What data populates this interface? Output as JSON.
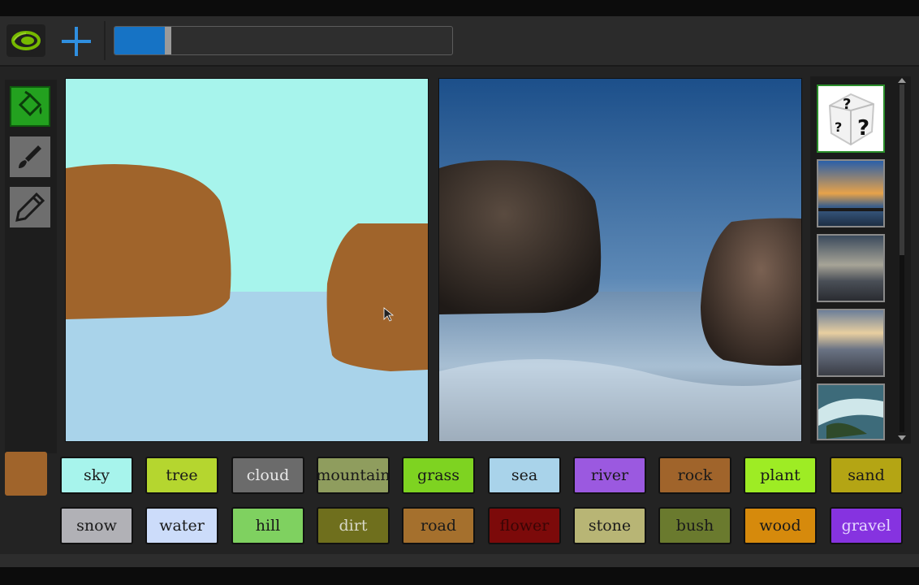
{
  "app": {
    "progress_percent": 15
  },
  "tools": [
    {
      "name": "paint-bucket",
      "active": true
    },
    {
      "name": "brush",
      "active": false
    },
    {
      "name": "pencil",
      "active": false
    }
  ],
  "current_color": "#a0642b",
  "palette": [
    {
      "label": "sky",
      "color": "#a7f4ec",
      "text": "#1a1a1a"
    },
    {
      "label": "tree",
      "color": "#b5d62f",
      "text": "#1a1a1a"
    },
    {
      "label": "cloud",
      "color": "#6b6b6b",
      "text": "#e8e8e8"
    },
    {
      "label": "mountain",
      "color": "#8f9d5e",
      "text": "#1a1a1a"
    },
    {
      "label": "grass",
      "color": "#7ed321",
      "text": "#1a1a1a"
    },
    {
      "label": "sea",
      "color": "#a9d3ea",
      "text": "#1a1a1a"
    },
    {
      "label": "river",
      "color": "#9b59e0",
      "text": "#1a1a1a"
    },
    {
      "label": "rock",
      "color": "#a0642b",
      "text": "#1a1a1a"
    },
    {
      "label": "plant",
      "color": "#9eec24",
      "text": "#1a1a1a"
    },
    {
      "label": "sand",
      "color": "#b4a514",
      "text": "#1a1a1a"
    },
    {
      "label": "snow",
      "color": "#b1b1b6",
      "text": "#1a1a1a"
    },
    {
      "label": "water",
      "color": "#ccdcfa",
      "text": "#1a1a1a"
    },
    {
      "label": "hill",
      "color": "#7fd160",
      "text": "#1a1a1a"
    },
    {
      "label": "dirt",
      "color": "#6f6f1d",
      "text": "#d8d8c8"
    },
    {
      "label": "road",
      "color": "#a5702d",
      "text": "#1a1a1a"
    },
    {
      "label": "flower",
      "color": "#7c0a0a",
      "text": "#3a0505"
    },
    {
      "label": "stone",
      "color": "#b8b575",
      "text": "#1a1a1a"
    },
    {
      "label": "bush",
      "color": "#6a7a2e",
      "text": "#1a1a1a"
    },
    {
      "label": "wood",
      "color": "#d68a0c",
      "text": "#1a1a1a"
    },
    {
      "label": "gravel",
      "color": "#8633e0",
      "text": "#e6d8ff"
    }
  ],
  "gallery": [
    {
      "name": "random-style",
      "selected": true
    },
    {
      "name": "sunset-coast",
      "selected": false
    },
    {
      "name": "stormy-sky",
      "selected": false
    },
    {
      "name": "cloudy-shore",
      "selected": false
    },
    {
      "name": "rocky-stream",
      "selected": false
    }
  ]
}
